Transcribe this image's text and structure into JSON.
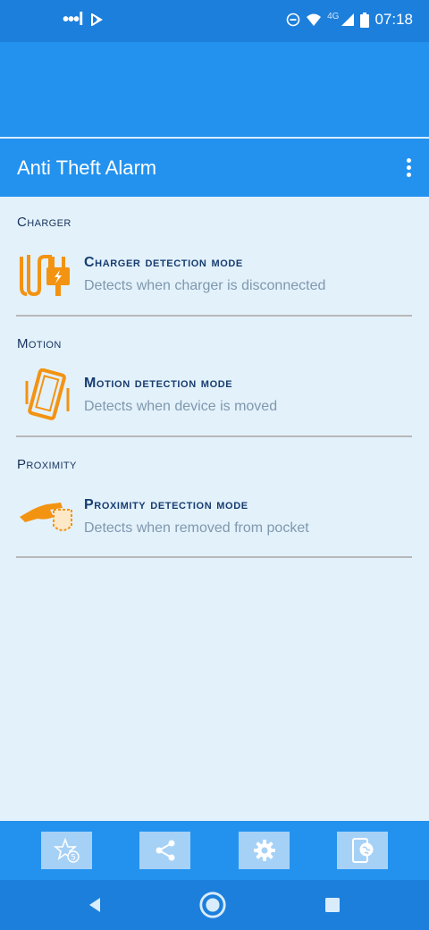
{
  "status_bar": {
    "time": "07:18",
    "network": "4G"
  },
  "app": {
    "title": "Anti Theft Alarm"
  },
  "sections": [
    {
      "header": "Charger",
      "title": "Charger detection mode",
      "subtitle": "Detects when charger is disconnected",
      "icon": "charger-plug-icon"
    },
    {
      "header": "Motion",
      "title": "Motion detection mode",
      "subtitle": "Detects when device is moved",
      "icon": "phone-vibrate-icon"
    },
    {
      "header": "Proximity",
      "title": "Proximity detection mode",
      "subtitle": "Detects when removed from pocket",
      "icon": "hand-pocket-icon"
    }
  ],
  "bottom_bar": {
    "buttons": [
      "rate-star-icon",
      "share-icon",
      "settings-gear-icon",
      "more-apps-icon"
    ]
  },
  "colors": {
    "primary": "#2392ef",
    "status": "#1c7fdc",
    "background": "#e3f1fb",
    "accent": "#f39312",
    "title_text": "#173d70",
    "subtitle_text": "#7f98ad"
  }
}
